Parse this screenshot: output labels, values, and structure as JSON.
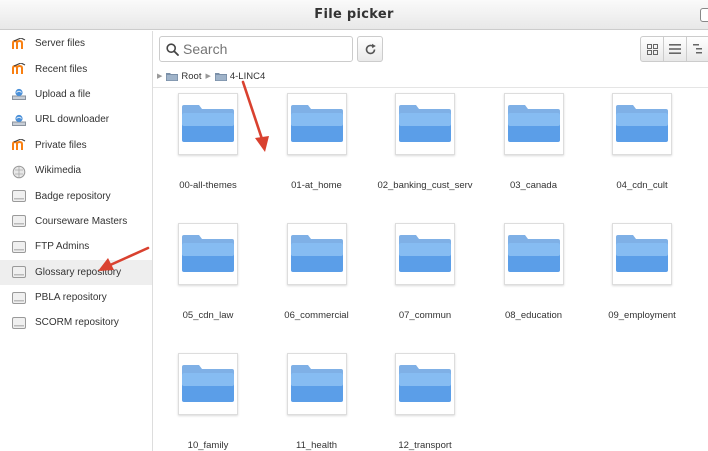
{
  "window": {
    "title": "File picker"
  },
  "sidebar": {
    "items": [
      {
        "label": "Server files",
        "icon": "moodle-icon"
      },
      {
        "label": "Recent files",
        "icon": "moodle-icon"
      },
      {
        "label": "Upload a file",
        "icon": "upload-icon"
      },
      {
        "label": "URL downloader",
        "icon": "upload-icon"
      },
      {
        "label": "Private files",
        "icon": "moodle-icon"
      },
      {
        "label": "Wikimedia",
        "icon": "wikimedia-icon"
      },
      {
        "label": "Badge repository",
        "icon": "repository-icon"
      },
      {
        "label": "Courseware Masters",
        "icon": "repository-icon"
      },
      {
        "label": "FTP Admins",
        "icon": "repository-icon"
      },
      {
        "label": "Glossary repository",
        "icon": "repository-icon",
        "active": true
      },
      {
        "label": "PBLA repository",
        "icon": "repository-icon"
      },
      {
        "label": "SCORM repository",
        "icon": "repository-icon"
      }
    ]
  },
  "toolbar": {
    "search_placeholder": "Search"
  },
  "breadcrumb": [
    {
      "label": "Root"
    },
    {
      "label": "4-LINC4"
    }
  ],
  "folders": [
    "00-all-themes",
    "01-at_home",
    "02_banking_cust_serv",
    "03_canada",
    "04_cdn_cult",
    "05_cdn_law",
    "06_commercial",
    "07_commun",
    "08_education",
    "09_employment",
    "10_family",
    "11_health",
    "12_transport"
  ],
  "colors": {
    "accent_arrow": "#d9412f",
    "folder_blue": "#6aa4e6"
  }
}
